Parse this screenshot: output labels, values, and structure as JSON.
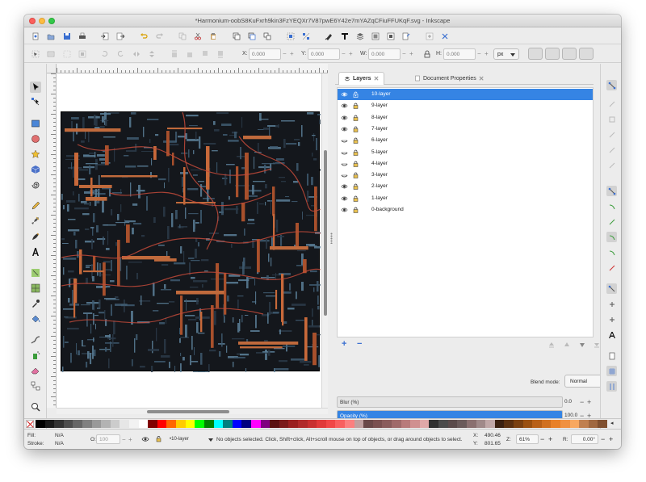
{
  "window": {
    "title": "*Harmonium-oobS8KuFxrh9kin3FzYEQXr7V87pwE6Y42e7mYAZqCFiuFFUKqF.svg - Inkscape"
  },
  "controls": {
    "x_label": "X:",
    "x_value": "0.000",
    "y_label": "Y:",
    "y_value": "0.000",
    "w_label": "W:",
    "w_value": "0.000",
    "h_label": "H:",
    "h_value": "0.000",
    "unit": "px"
  },
  "ruler": {
    "ticks": [
      "-200",
      "|0",
      "|200",
      "|300",
      "|400",
      "|500",
      "|600",
      "|700",
      "|800",
      "|900",
      "|1000",
      "|1100",
      "|1200",
      "|1300",
      "|1400",
      "|1500",
      "|1600",
      "|1700"
    ]
  },
  "dock": {
    "tab_layers": "Layers",
    "tab_docprops": "Document Properties",
    "layers": [
      {
        "name": "10-layer",
        "visible": true,
        "locked": false,
        "selected": true
      },
      {
        "name": "9-layer",
        "visible": true,
        "locked": true,
        "selected": false
      },
      {
        "name": "8-layer",
        "visible": true,
        "locked": true,
        "selected": false
      },
      {
        "name": "7-layer",
        "visible": true,
        "locked": true,
        "selected": false
      },
      {
        "name": "6-layer",
        "visible": false,
        "locked": true,
        "selected": false
      },
      {
        "name": "5-layer",
        "visible": false,
        "locked": true,
        "selected": false
      },
      {
        "name": "4-layer",
        "visible": false,
        "locked": true,
        "selected": false
      },
      {
        "name": "3-layer",
        "visible": false,
        "locked": true,
        "selected": false
      },
      {
        "name": "2-layer",
        "visible": true,
        "locked": true,
        "selected": false
      },
      {
        "name": "1-layer",
        "visible": true,
        "locked": true,
        "selected": false
      },
      {
        "name": "0-background",
        "visible": true,
        "locked": true,
        "selected": false
      }
    ],
    "add_label": "+",
    "remove_label": "−",
    "blend_label": "Blend mode:",
    "blend_value": "Normal",
    "blur_label": "Blur (%)",
    "blur_value": "0.0",
    "opacity_label": "Opacity (%)",
    "opacity_value": "100.0",
    "opacity_fraction": 1.0
  },
  "status": {
    "fill_label": "Fill:",
    "fill_value": "N/A",
    "stroke_label": "Stroke:",
    "stroke_value": "N/A",
    "o_label": "O:",
    "o_value": "100",
    "current_layer": "•10-layer",
    "message": "No objects selected. Click, Shift+click, Alt+scroll mouse on top of objects, or drag around objects to select.",
    "x_label": "X:",
    "x_value": "490.46",
    "y_label": "Y:",
    "y_value": "801.65",
    "z_label": "Z:",
    "zoom_value": "61%",
    "r_label": "R:",
    "rotation_value": "0.00°",
    "minus": "−",
    "plus": "+"
  },
  "colors": {
    "accent": "#3584e4",
    "palette": [
      "#000000",
      "#1a1a1a",
      "#333333",
      "#4d4d4d",
      "#666666",
      "#808080",
      "#999999",
      "#b3b3b3",
      "#cccccc",
      "#e6e6e6",
      "#f2f2f2",
      "#ffffff",
      "#800000",
      "#ff0000",
      "#ff6600",
      "#ffcc00",
      "#ffff00",
      "#00ff00",
      "#008000",
      "#00ffff",
      "#008080",
      "#0000ff",
      "#000080",
      "#ff00ff",
      "#800080",
      "#5a1010",
      "#7a1a1a",
      "#9a2020",
      "#b02a2a",
      "#c83030",
      "#e03a3a",
      "#f04848",
      "#f86060",
      "#fb8080",
      "#c0a0a0",
      "#6a4848",
      "#7a5050",
      "#8a5c5c",
      "#a06a6a",
      "#b87a7a",
      "#d09090",
      "#e0a8a8",
      "#303030",
      "#4a4a4a",
      "#5a4a4a",
      "#6a5a5a",
      "#8a7070",
      "#a08a8a",
      "#c0a8a8",
      "#3a2010",
      "#5a3010",
      "#7a4010",
      "#9a5010",
      "#b86018",
      "#d07020",
      "#e88028",
      "#f09040",
      "#f8a860",
      "#c08050",
      "#a06840",
      "#805030"
    ]
  }
}
